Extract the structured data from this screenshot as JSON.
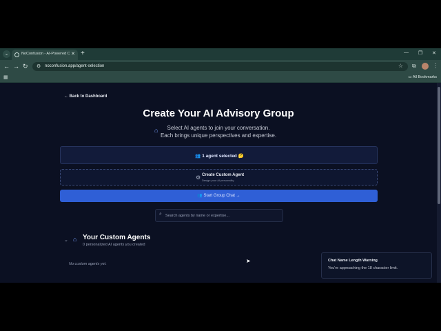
{
  "browser": {
    "tab_title": "NoConfusion - AI-Powered Co",
    "tab_close": "✕",
    "new_tab": "+",
    "url": "noconfusion.app/agent-selection",
    "all_bookmarks": "All Bookmarks",
    "window_controls": [
      "—",
      "❐",
      "✕"
    ]
  },
  "page": {
    "back_link": "← Back to Dashboard",
    "title": "Create Your AI Advisory Group",
    "subtitle_line1": "Select AI agents to join your conversation.",
    "subtitle_line2": "Each brings unique perspectives and expertise.",
    "selected_count": "1 agent selected",
    "create_agent_title": "Create Custom Agent",
    "create_agent_sub": "Design your AI personality",
    "start_button": "Start Group Chat  →",
    "search_placeholder": "Search agents by name or expertise...",
    "section_title": "Your Custom Agents",
    "section_sub": "0 personalized AI agents you created",
    "empty_text": "No custom agents yet."
  },
  "toast": {
    "title": "Chat Name Length Warning",
    "message": "You're approaching the 18 character limit."
  },
  "colors": {
    "background": "#0b1022",
    "accent": "#2f5fd6",
    "chrome": "#2e4a45"
  },
  "icons": [
    "globe-icon",
    "settings-sliders-icon",
    "star-icon",
    "extension-icon",
    "apps-grid-icon",
    "folder-icon",
    "users-icon",
    "emoji-icon",
    "robot-icon",
    "search-icon",
    "chevron-down-icon",
    "cursor-icon"
  ]
}
